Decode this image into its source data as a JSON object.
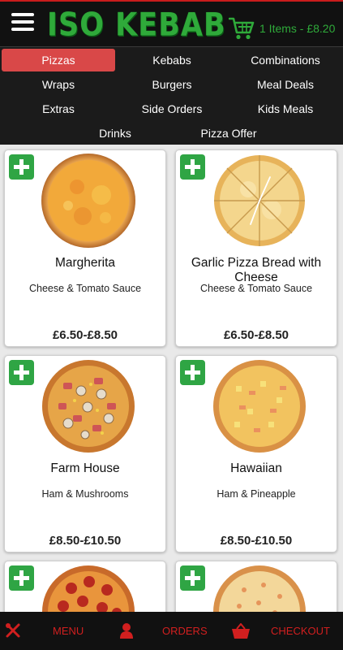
{
  "header": {
    "logo": "ISO KEBAB",
    "cart_text": "1 Items - £8.20"
  },
  "nav": {
    "items": [
      "Pizzas",
      "Kebabs",
      "Combinations",
      "Wraps",
      "Burgers",
      "Meal Deals",
      "Extras",
      "Side Orders",
      "Kids Meals",
      "Drinks",
      "Pizza Offer"
    ],
    "active": "Pizzas"
  },
  "products": [
    {
      "title": "Margherita",
      "description": "Cheese & Tomato Sauce",
      "price": "£6.50-£8.50",
      "image": "margherita-pizza"
    },
    {
      "title": "Garlic Pizza Bread with Cheese",
      "description": "Cheese & Tomato Sauce",
      "price": "£6.50-£8.50",
      "image": "garlic-bread-pizza"
    },
    {
      "title": "Farm House",
      "description": "Ham & Mushrooms",
      "price": "£8.50-£10.50",
      "image": "farmhouse-pizza"
    },
    {
      "title": "Hawaiian",
      "description": "Ham & Pineapple",
      "price": "£8.50-£10.50",
      "image": "hawaiian-pizza"
    },
    {
      "title": "",
      "description": "",
      "price": "",
      "image": "pepperoni-pizza"
    },
    {
      "title": "",
      "description": "",
      "price": "",
      "image": "cheese-pizza"
    }
  ],
  "bottom_bar": {
    "menu_label": "MENU",
    "orders_label": "ORDERS",
    "checkout_label": "CHECKOUT",
    "accent_color": "#d11f1f"
  },
  "colors": {
    "brand_green": "#2faa3a",
    "active_tab": "#d94848",
    "add_button": "#2fa544"
  }
}
